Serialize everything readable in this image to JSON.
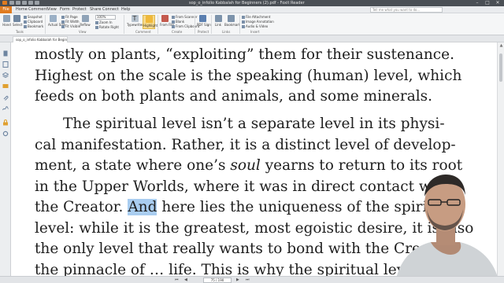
{
  "window": {
    "title": "sop_o_infolio Kabbalah for Beginners (2).pdf - Foxit Reader",
    "controls": {
      "minimize": "–",
      "maximize": "□",
      "close": "✕"
    }
  },
  "menu": {
    "tabs": [
      "File",
      "Home",
      "Comment",
      "View",
      "Form",
      "Protect",
      "Share",
      "Connect",
      "Help"
    ],
    "search_placeholder": "Tell me what you want to do..."
  },
  "ribbon": {
    "hand": "Hand",
    "select": "Select",
    "snapshot": "Snapshot",
    "clipboard": "Clipboard",
    "bookmark": "Bookmark",
    "actual_size": "Actual Size",
    "fit_page": "Fit Page",
    "fit_width": "Fit Width",
    "fit_visible": "Fit Visible",
    "reflow": "Reflow",
    "zoom_value": "100%",
    "zoom_in": "Zoom In",
    "zoom_out": "Zoom Out",
    "rotate_left": "Rotate Left",
    "rotate_right": "Rotate Right",
    "typewriter": "Typewriter",
    "highlight": "Highlight",
    "from_file": "From File",
    "from_scanner": "From Scanner",
    "blank": "Blank",
    "from_clipboard": "From Clipboard",
    "pdf_sign": "PDF Sign",
    "link": "Link",
    "bookmark2": "Bookmark",
    "file_attachment": "File Attachment",
    "image_annotation": "Image Annotation",
    "audio_video": "Audio & Video",
    "groups": [
      "Tools",
      "View",
      "Comment",
      "Create",
      "Protect",
      "Links",
      "Insert"
    ]
  },
  "tab": {
    "label": "sop_o_infolio Kabbalah for Beginners (2).pdf"
  },
  "document": {
    "lines": [
      [
        "mostly on plants, “exploiting” them for their sustenance."
      ],
      [
        "Highest on the scale is the speaking (human) level, which"
      ],
      [
        "feeds on both plants and animals, and some minerals."
      ],
      [
        "The spiritual level isn’t a separate level in its physi-"
      ],
      [
        "cal manifestation. Rather, it is a distinct level of develop-"
      ],
      [
        "ment, a state where one’s ",
        "soul",
        " yearns to return to its root"
      ],
      [
        "in the Upper Worlds, where it was in direct contact with"
      ],
      [
        "the Creator. ",
        "And",
        " here lies the uniqueness of the spiritual"
      ],
      [
        "level: while it is the greatest, most egoistic desire, it is also"
      ],
      [
        "the only level that really wants to bond with the Creator,"
      ],
      [
        "the pinnacle of … life. This is why the spiritual level is"
      ]
    ]
  },
  "status": {
    "page": "75 / 190",
    "nav": {
      "first": "⏮",
      "prev": "◀",
      "next": "▶",
      "last": "⏭"
    }
  },
  "colors": {
    "file_tab": "#e07b1f",
    "selection": "#a9cdf0",
    "titlebar": "#4a4f55"
  }
}
